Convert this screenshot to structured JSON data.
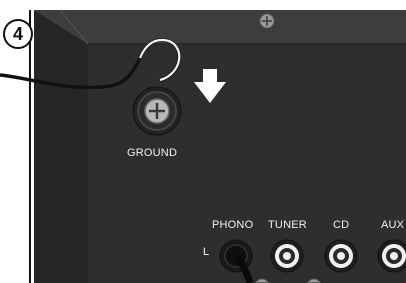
{
  "step": {
    "number": "4"
  },
  "labels": {
    "ground": "GROUND",
    "phono": "PHONO",
    "tuner": "TUNER",
    "cd": "CD",
    "aux": "AUX",
    "channel_left": "L"
  },
  "icons": {
    "arrow": "down-arrow-icon",
    "screw": "screw-icon"
  },
  "colors": {
    "panel": "#2f2f2f",
    "panel_dark": "#232323",
    "label_text": "#f2f2f2",
    "arrow": "#ffffff"
  }
}
